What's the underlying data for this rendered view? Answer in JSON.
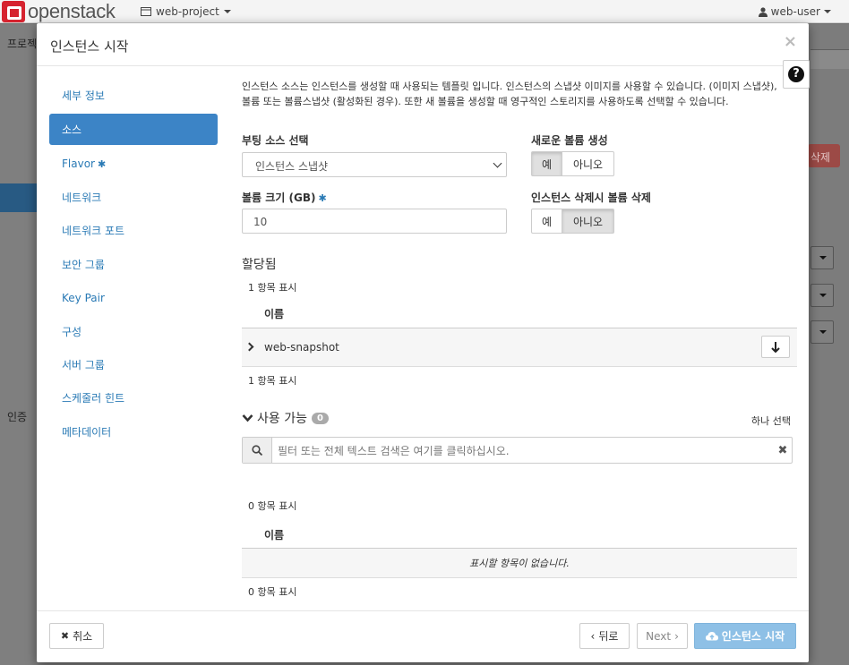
{
  "topbar": {
    "brand": "openstack",
    "project": "web-project",
    "user": "web-user"
  },
  "background": {
    "sidebar_labels": [
      "프로젝",
      "인증"
    ],
    "delete_button": "삭제"
  },
  "modal": {
    "title": "인스턴스 시작",
    "close_symbol": "×",
    "help_symbol": "?",
    "nav": [
      {
        "label": "세부 정보"
      },
      {
        "label": "소스",
        "active": true
      },
      {
        "label": "Flavor",
        "required_marker": "✱"
      },
      {
        "label": "네트워크"
      },
      {
        "label": "네트워크 포트"
      },
      {
        "label": "보안 그룹"
      },
      {
        "label": "Key Pair"
      },
      {
        "label": "구성"
      },
      {
        "label": "서버 그룹"
      },
      {
        "label": "스케줄러 힌트"
      },
      {
        "label": "메타데이터"
      }
    ],
    "intro_text": "인스턴스 소스는 인스턴스를 생성할 때 사용되는 템플릿 입니다. 인스턴스의 스냅샷 이미지를 사용할 수 있습니다. (이미지 스냅샷), 볼륨 또는 볼륨스냅샷 (활성화된 경우). 또한 새 볼륨을 생성할 때 영구적인 스토리지를 사용하도록 선택할 수 있습니다.",
    "boot_source": {
      "label": "부팅 소스 선택",
      "value": "인스턴스 스냅샷"
    },
    "create_volume": {
      "label": "새로운 볼륨 생성",
      "yes": "예",
      "no": "아니오",
      "selected": "예"
    },
    "volume_size": {
      "label": "볼륨 크기 (GB)",
      "required_marker": "✱",
      "value": "10"
    },
    "delete_volume": {
      "label": "인스턴스 삭제시 볼륨 삭제",
      "yes": "예",
      "no": "아니오",
      "selected": "아니오"
    },
    "allocated": {
      "title": "할당됨",
      "count_top": "1 항목 표시",
      "column_name": "이름",
      "rows": [
        {
          "name": "web-snapshot"
        }
      ],
      "count_bottom": "1 항목 표시"
    },
    "available": {
      "title": "사용 가능",
      "badge": "0",
      "select_hint": "하나 선택",
      "search_placeholder": "필터 또는 전체 텍스트 검색은 여기를 클릭하십시오.",
      "count_top": "0 항목 표시",
      "column_name": "이름",
      "empty_message": "표시할 항목이 없습니다.",
      "count_bottom": "0 항목 표시"
    },
    "footer": {
      "cancel": "취소",
      "back": "뒤로",
      "next": "Next",
      "launch": "인스턴스 시작"
    }
  },
  "colors": {
    "nav_active": "#3c84c6",
    "link": "#2a7ab5",
    "primary_disabled": "#8ec0e6"
  }
}
